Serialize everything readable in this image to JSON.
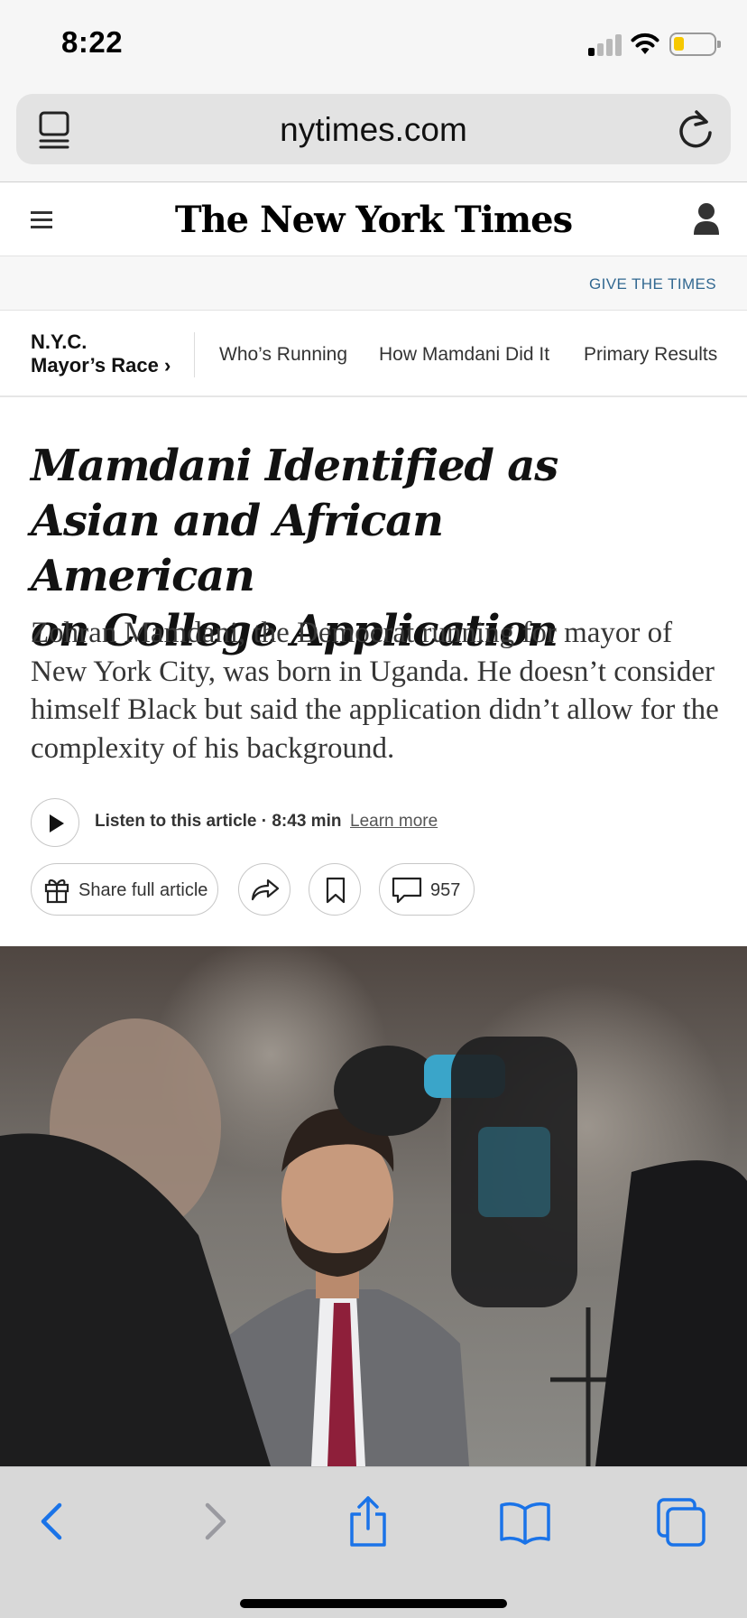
{
  "status_bar": {
    "time": "8:22"
  },
  "browser": {
    "url": "nytimes.com"
  },
  "header": {
    "masthead": "The New York Times",
    "give_link": "GIVE THE TIMES"
  },
  "section_nav": {
    "title_line1": "N.Y.C.",
    "title_line2": "Mayor’s Race ›",
    "links": [
      "Who’s Running",
      "How Mamdani Did It",
      "Primary Results"
    ]
  },
  "article": {
    "headline_lines": [
      "Mamdani Identified as",
      "Asian and African American",
      "on College Application"
    ],
    "summary": "Zohran Mamdani, the Democrat running for mayor of New York City, was born in Uganda. He doesn’t consider himself Black but said the application didn’t allow for the complexity of his background.",
    "listen_label": "Listen to this article · 8:43 min",
    "learn_more": "Learn more",
    "share_label": "Share full article",
    "comment_count": "957"
  },
  "icons": {
    "reader": "reader-mode-icon",
    "reload": "reload-icon",
    "menu": "hamburger-menu-icon",
    "account": "account-icon",
    "play": "play-icon",
    "gift": "gift-icon",
    "share": "share-arrow-icon",
    "bookmark": "bookmark-icon",
    "comment": "comment-bubble-icon",
    "back": "chevron-left-icon",
    "forward": "chevron-right-icon",
    "share_sheet": "share-sheet-icon",
    "bookmarks": "open-book-icon",
    "tabs": "tabs-icon"
  },
  "colors": {
    "link_blue": "#326891",
    "ios_blue": "#1a73e8",
    "battery_yellow": "#f6c800"
  }
}
